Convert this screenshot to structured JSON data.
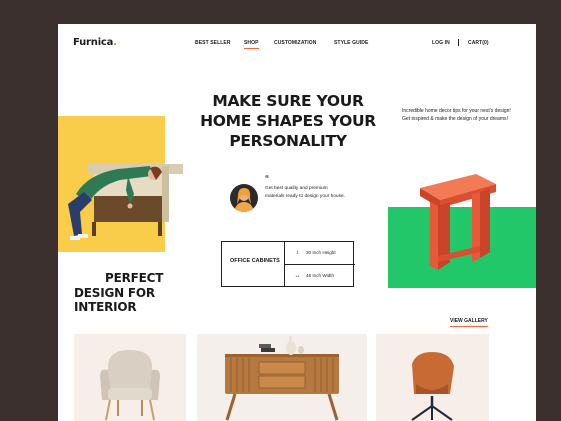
{
  "brand": {
    "name": "Furnica",
    "dot": ".",
    "accent": "#f2673b"
  },
  "nav": {
    "links": [
      "BEST SELLER",
      "SHOP",
      "CUSTOMIZATION",
      "STYLE GUIDE"
    ],
    "active": "SHOP",
    "login": "LOG IN",
    "separator": "|",
    "cart": "CART(0)"
  },
  "hero": {
    "headline_lines": [
      "MAKE SURE YOUR",
      "HOME SHAPES YOUR",
      "PERSONALITY"
    ],
    "intro": "Incredible home decor tips for your nest's design! Get inspired & make the design of your dreams!",
    "quote_mark": "“",
    "quote": "Get best quality and premium materials ready to design your house.",
    "colors": {
      "yellow": "#f9cd4a",
      "green": "#22c76a",
      "orange_table": "#ee5a3a"
    }
  },
  "spec": {
    "title": "OFFICE CABINETS",
    "height_icon": "height-arrow-icon",
    "height": "30 Inch Height",
    "width_icon": "width-arrow-icon",
    "width": "48 Inch Width"
  },
  "section": {
    "title_lines": [
      "PERFECT",
      "DESIGN FOR",
      "INTERIOR"
    ],
    "gallery_link": "VIEW GALLERY"
  },
  "products": [
    {
      "name": "armchair-icon"
    },
    {
      "name": "sideboard-icon"
    },
    {
      "name": "leather-chair-icon"
    }
  ]
}
